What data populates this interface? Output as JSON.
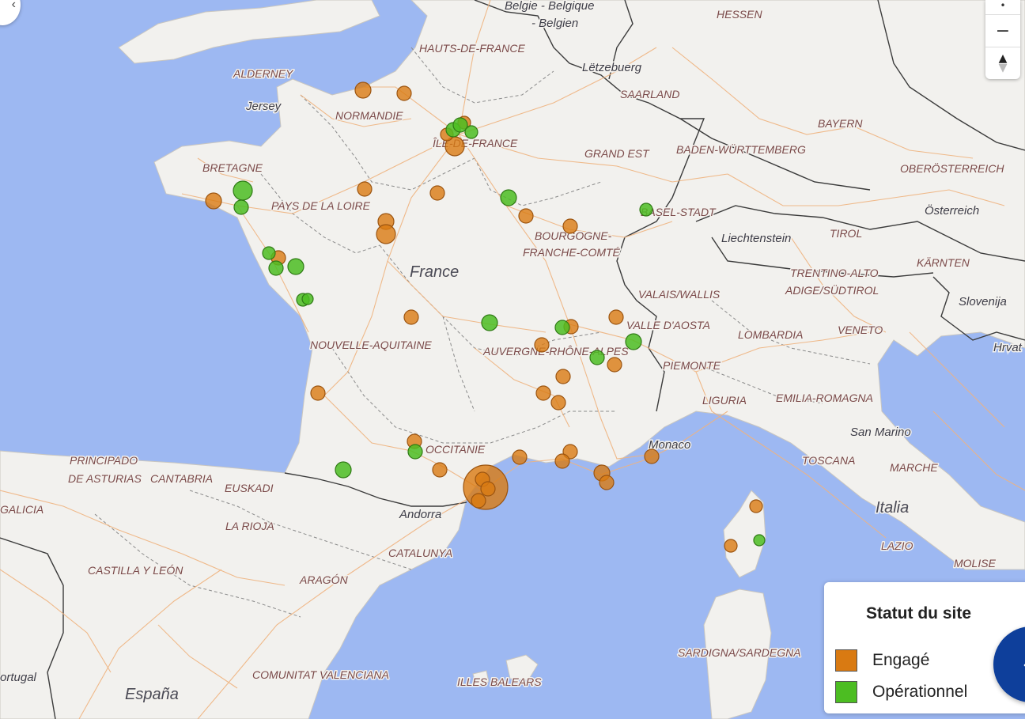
{
  "map": {
    "country_label": "France",
    "countries": [
      {
        "id": "belgique",
        "text": "Belgie - Belgique"
      },
      {
        "id": "belgien",
        "text": "- Belgien"
      },
      {
        "id": "letzebuerg",
        "text": "Lëtzebuerg"
      },
      {
        "id": "liechtenstein",
        "text": "Liechtenstein"
      },
      {
        "id": "osterreich",
        "text": "Österreich"
      },
      {
        "id": "slovenija",
        "text": "Slovenija"
      },
      {
        "id": "hrvat",
        "text": "Hrvat"
      },
      {
        "id": "monaco",
        "text": "Monaco"
      },
      {
        "id": "san-marino",
        "text": "San Marino"
      },
      {
        "id": "italia",
        "text": "Italia"
      },
      {
        "id": "andorra",
        "text": "Andorra"
      },
      {
        "id": "espana",
        "text": "España"
      },
      {
        "id": "portugal",
        "text": "ortugal"
      },
      {
        "id": "jersey",
        "text": "Jersey"
      }
    ],
    "regions": [
      {
        "id": "hessen",
        "text": "HESSEN"
      },
      {
        "id": "hauts-de-france",
        "text": "HAUTS-DE-FRANCE"
      },
      {
        "id": "alderney",
        "text": "ALDERNEY"
      },
      {
        "id": "saarland",
        "text": "SAARLAND"
      },
      {
        "id": "normandie",
        "text": "NORMANDIE"
      },
      {
        "id": "bayern",
        "text": "BAYERN"
      },
      {
        "id": "ile-de-france",
        "text": "ÎLE-DE-FRANCE"
      },
      {
        "id": "grand-est",
        "text": "GRAND EST"
      },
      {
        "id": "baden-wurttemberg",
        "text": "BADEN-WÜRTTEMBERG"
      },
      {
        "id": "bretagne",
        "text": "BRETAGNE"
      },
      {
        "id": "oberosterreich",
        "text": "OBERÖSTERREICH"
      },
      {
        "id": "pays-de-la-loire",
        "text": "PAYS DE LA LOIRE"
      },
      {
        "id": "basel-stadt",
        "text": "BASEL-STADT"
      },
      {
        "id": "bourgogne",
        "text": "BOURGOGNE-"
      },
      {
        "id": "franche-comte",
        "text": "FRANCHE-COMTÉ"
      },
      {
        "id": "tirol",
        "text": "TIROL"
      },
      {
        "id": "karnten",
        "text": "KÄRNTEN"
      },
      {
        "id": "trentino",
        "text": "TRENTINO-ALTO"
      },
      {
        "id": "adige",
        "text": "ADIGE/SÜDTIROL"
      },
      {
        "id": "valais",
        "text": "VALAIS/WALLIS"
      },
      {
        "id": "valle-aosta",
        "text": "VALLE D'AOSTA"
      },
      {
        "id": "lombardia",
        "text": "LOMBARDIA"
      },
      {
        "id": "veneto",
        "text": "VENETO"
      },
      {
        "id": "nouvelle-aquitaine",
        "text": "NOUVELLE-AQUITAINE"
      },
      {
        "id": "auvergne",
        "text": "AUVERGNE-RHÔNE-ALPES"
      },
      {
        "id": "piemonte",
        "text": "PIEMONTE"
      },
      {
        "id": "liguria",
        "text": "LIGURIA"
      },
      {
        "id": "emilia-romagna",
        "text": "EMILIA-ROMAGNA"
      },
      {
        "id": "occitanie",
        "text": "OCCITANIE"
      },
      {
        "id": "principado",
        "text": "PRINCIPADO"
      },
      {
        "id": "asturias",
        "text": "DE ASTURIAS"
      },
      {
        "id": "cantabria",
        "text": "CANTABRIA"
      },
      {
        "id": "euskadi",
        "text": "EUSKADI"
      },
      {
        "id": "toscana",
        "text": "TOSCANA"
      },
      {
        "id": "marche",
        "text": "MARCHE"
      },
      {
        "id": "galicia",
        "text": "GALICIA"
      },
      {
        "id": "la-rioja",
        "text": "LA RIOJA"
      },
      {
        "id": "lazio",
        "text": "LAZIO"
      },
      {
        "id": "molise",
        "text": "MOLISE"
      },
      {
        "id": "catalunya",
        "text": "CATALUNYA"
      },
      {
        "id": "castilla",
        "text": "CASTILLA Y LEÓN"
      },
      {
        "id": "aragon",
        "text": "ARAGÓN"
      },
      {
        "id": "sardegna",
        "text": "SARDIGNA/SARDEGNA"
      },
      {
        "id": "valenciana",
        "text": "COMUNITAT VALENCIANA"
      },
      {
        "id": "baleares",
        "text": "ILLES BALEARS"
      }
    ]
  },
  "controls": {
    "zoom_in_icon": "plus-icon",
    "zoom_out_label": "−",
    "reset_north_label": "▲"
  },
  "legend": {
    "title": "Statut du site",
    "items": [
      {
        "label": "Engagé",
        "color": "#d97a12"
      },
      {
        "label": "Opérationnel",
        "color": "#4cbd22"
      }
    ]
  },
  "colors": {
    "sea": "#9db8f2",
    "land": "#f2f1ee",
    "engage": "#d97a12",
    "operationnel": "#4cbd22",
    "fab": "#0e3f9b"
  }
}
